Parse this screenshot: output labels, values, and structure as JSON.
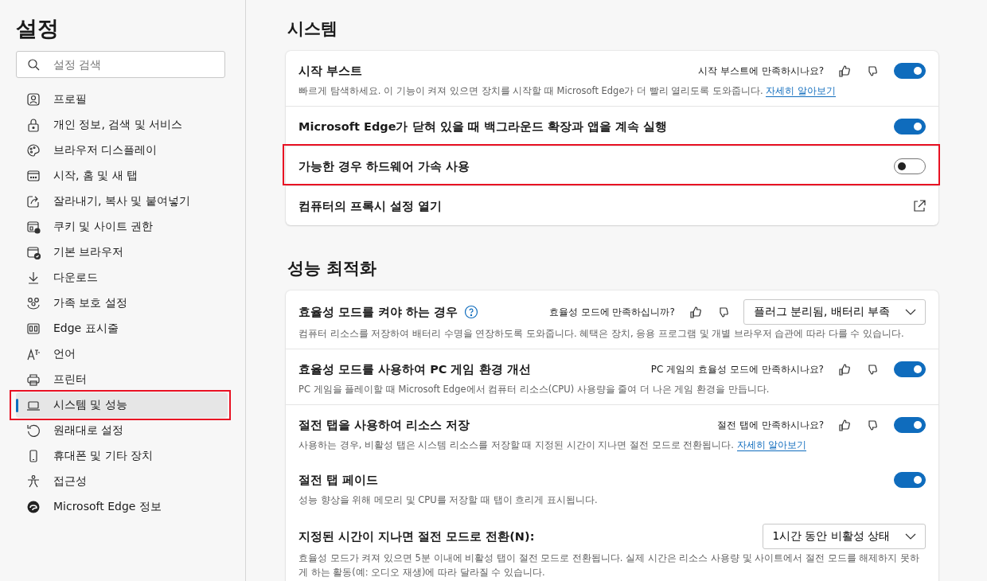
{
  "sidebar": {
    "title": "설정",
    "search": {
      "placeholder": "설정 검색"
    },
    "items": [
      {
        "label": "프로필",
        "selected": false,
        "highlighted": false
      },
      {
        "label": "개인 정보, 검색 및 서비스",
        "selected": false,
        "highlighted": false
      },
      {
        "label": "브라우저 디스플레이",
        "selected": false,
        "highlighted": false
      },
      {
        "label": "시작, 홈 및 새 탭",
        "selected": false,
        "highlighted": false
      },
      {
        "label": "잘라내기, 복사 및 붙여넣기",
        "selected": false,
        "highlighted": false
      },
      {
        "label": "쿠키 및 사이트 권한",
        "selected": false,
        "highlighted": false
      },
      {
        "label": "기본 브라우저",
        "selected": false,
        "highlighted": false
      },
      {
        "label": "다운로드",
        "selected": false,
        "highlighted": false
      },
      {
        "label": "가족 보호 설정",
        "selected": false,
        "highlighted": false
      },
      {
        "label": "Edge 표시줄",
        "selected": false,
        "highlighted": false
      },
      {
        "label": "언어",
        "selected": false,
        "highlighted": false
      },
      {
        "label": "프린터",
        "selected": false,
        "highlighted": false
      },
      {
        "label": "시스템 및 성능",
        "selected": true,
        "highlighted": true
      },
      {
        "label": "원래대로 설정",
        "selected": false,
        "highlighted": false
      },
      {
        "label": "휴대폰 및 기타 장치",
        "selected": false,
        "highlighted": false
      },
      {
        "label": "접근성",
        "selected": false,
        "highlighted": false
      },
      {
        "label": "Microsoft Edge 정보",
        "selected": false,
        "highlighted": false
      }
    ]
  },
  "sections": [
    {
      "title": "시스템",
      "rows": [
        {
          "kind": "toggle",
          "title": "시작 부스트",
          "feedback": "시작 부스트에 만족하시나요?",
          "on": true,
          "highlighted": false,
          "description": "빠르게 탐색하세요. 이 기능이 켜져 있으면 장치를 시작할 때 Microsoft Edge가 더 빨리 열리도록 도와줍니다.",
          "link": "자세히 알아보기"
        },
        {
          "kind": "toggle",
          "title": "Microsoft Edge가 닫혀 있을 때 백그라운드 확장과 앱을 계속 실행",
          "on": true,
          "highlighted": false
        },
        {
          "kind": "toggle",
          "title": "가능한 경우 하드웨어 가속 사용",
          "on": false,
          "highlighted": true
        },
        {
          "kind": "external",
          "title": "컴퓨터의 프록시 설정 열기",
          "highlighted": false
        }
      ]
    },
    {
      "title": "성능 최적화",
      "rows": [
        {
          "kind": "dropdown",
          "title": "효율성 모드를 켜야 하는 경우",
          "help": true,
          "feedback": "효율성 모드에 만족하십니까?",
          "value": "플러그 분리됨, 배터리 부족",
          "highlighted": false,
          "description": "컴퓨터 리소스를 저장하여 배터리 수명을 연장하도록 도와줍니다. 혜택은 장치, 응용 프로그램 및 개별 브라우저 습관에 따라 다를 수 있습니다."
        },
        {
          "kind": "toggle",
          "title": "효율성 모드를 사용하여 PC 게임 환경 개선",
          "feedback": "PC 게임의 효율성 모드에 만족하시나요?",
          "on": true,
          "highlighted": false,
          "description": "PC 게임을 플레이할 때 Microsoft Edge에서 컴퓨터 리소스(CPU) 사용량을 줄여 더 나은 게임 환경을 만듭니다."
        },
        {
          "kind": "toggle",
          "title": "절전 탭을 사용하여 리소스 저장",
          "feedback": "절전 탭에 만족하시나요?",
          "on": true,
          "highlighted": false,
          "description": "사용하는 경우, 비활성 탭은 시스템 리소스를 저장할 때 지정된 시간이 지나면 절전 모드로 전환됩니다.",
          "link": "자세히 알아보기"
        },
        {
          "kind": "toggle",
          "title": "절전 탭 페이드",
          "on": true,
          "highlighted": false,
          "sub": true,
          "description": "성능 향상을 위해 메모리 및 CPU를 저장할 때 탭이 흐리게 표시됩니다."
        },
        {
          "kind": "dropdown",
          "title": "지정된 시간이 지나면 절전 모드로 전환(N):",
          "value": "1시간 동안 비활성 상태",
          "highlighted": false,
          "sub": true,
          "description": "효율성 모드가 켜져 있으면 5분 이내에 비활성 탭이 절전 모드로 전환됩니다. 실제 시간은 리소스 사용량 및 사이트에서 절전 모드를 해제하지 못하게 하는 활동(예: 오디오 재생)에 따라 달라질 수 있습니다."
        }
      ]
    }
  ]
}
